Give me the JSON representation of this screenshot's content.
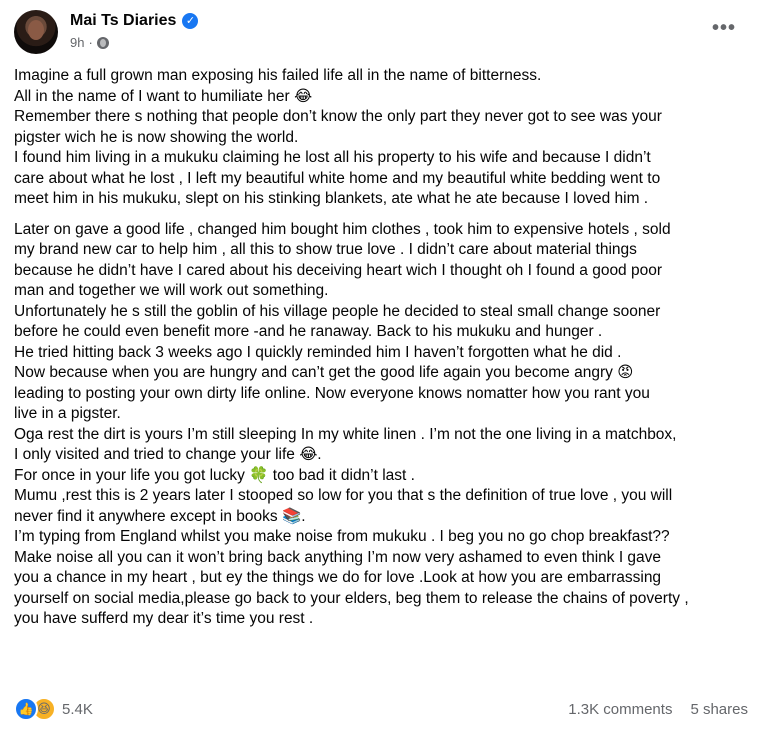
{
  "author": {
    "name": "Mai Ts Diaries",
    "time": "9h"
  },
  "icons": {
    "avatar": "profile-photo",
    "verified": "verified-badge-icon",
    "audience": "globe-icon",
    "more": "more-options-icon",
    "reactions": [
      "like-icon",
      "haha-icon"
    ]
  },
  "post": {
    "para1": [
      "Imagine a full grown man exposing his failed life all in the name of bitterness.",
      "All in the name of I want to humiliate her 😂",
      "Remember there s nothing that people don’t know the only part they never got to see was your",
      "pigster wich he is  now showing the world.",
      "I found him living in a mukuku claiming he lost all his property to his wife and because I didn’t",
      "care about what he lost , I left my beautiful white home and my beautiful white bedding went to",
      "meet him in his mukuku, slept on his stinking blankets, ate what he ate because I loved him ."
    ],
    "para2": [
      "Later on gave a good life , changed him bought him clothes , took him to expensive hotels , sold",
      "my brand new car to help him , all this to show true love . I didn’t care about material things",
      "because he didn’t have I cared about his deceiving heart wich I thought oh I found a good poor",
      "man and together we will work out something.",
      "Unfortunately he s still the goblin of his village people he decided to steal small change sooner",
      "before he could even benefit more -and he ranaway. Back to his mukuku and hunger .",
      "He tried hitting back 3 weeks ago I quickly reminded him I haven’t forgotten what he did .",
      "Now because when you are hungry and can’t get the good life again you become angry 😡",
      "leading to posting your own dirty life online. Now everyone knows nomatter how you rant you",
      "live in a pigster.",
      "Oga rest the dirt is yours I’m still sleeping In my white linen . I’m not the one living in a matchbox,",
      "I only visited and tried to change your life 😂.",
      "For once in your life you got lucky 🍀 too bad it didn’t last .",
      "Mumu ,rest this is 2 years later I stooped so low for you that s the definition of true love , you will",
      "never find it anywhere except in books 📚.",
      "I’m typing from England whilst you make noise from mukuku . I beg you no go chop breakfast??",
      "Make noise all you can it won’t bring back anything I’m now very ashamed to even think I gave",
      "you a chance in my heart , but ey the things we do for love .Look at how you are embarrassing",
      "yourself on social media,please go back to your elders, beg them to release the chains of poverty ,",
      "you have sufferd my dear it’s time you rest ."
    ]
  },
  "footer": {
    "reaction_count": "5.4K",
    "comments": "1.3K comments",
    "shares": "5 shares"
  },
  "colors": {
    "accent": "#1877f2",
    "muted": "#65676b",
    "text": "#050505"
  }
}
